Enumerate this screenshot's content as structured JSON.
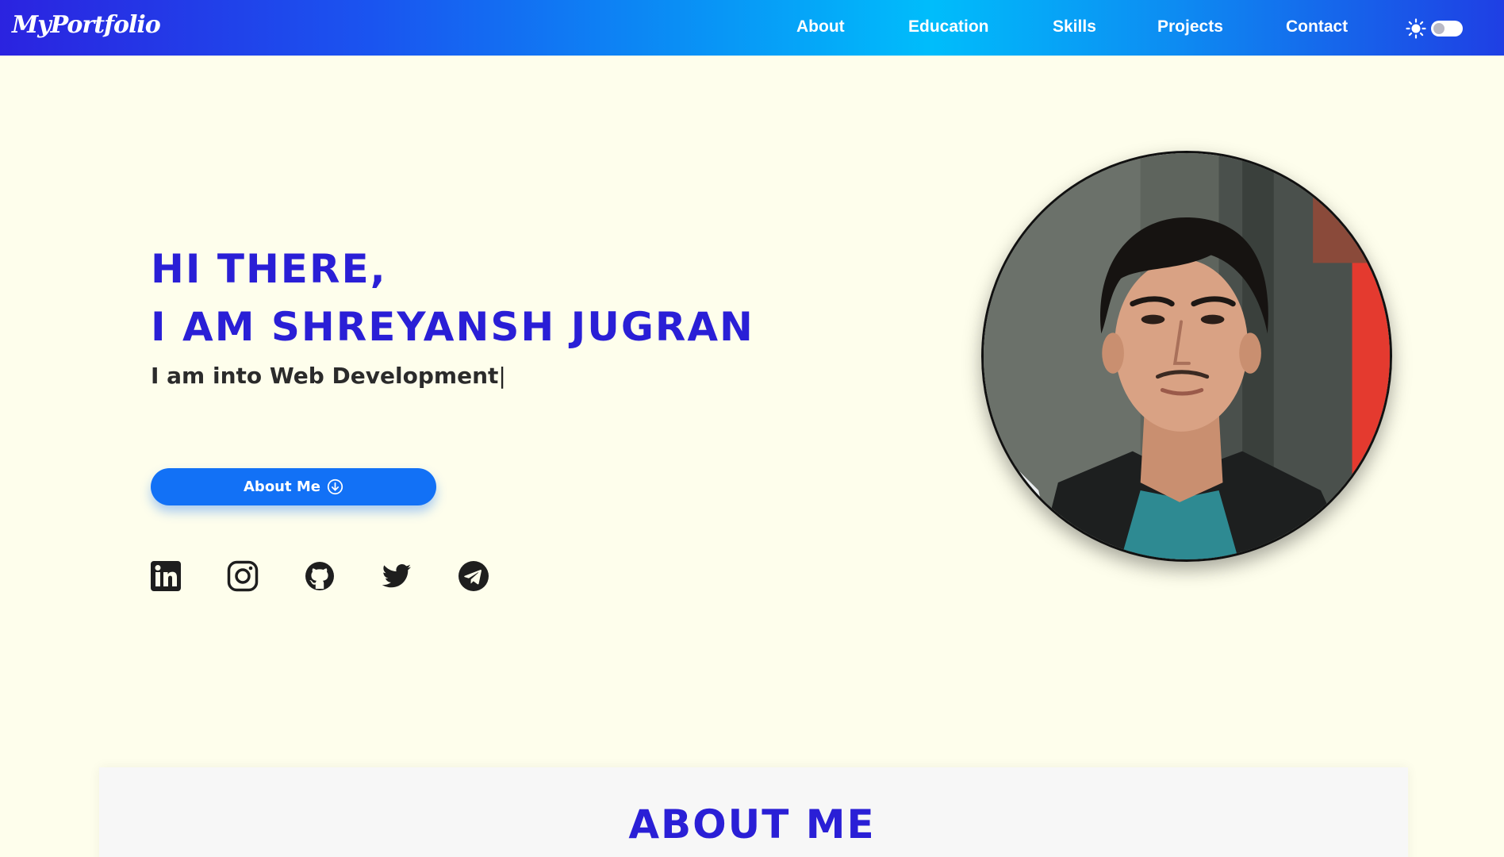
{
  "header": {
    "logo": "MyPortfolio",
    "nav": [
      "About",
      "Education",
      "Skills",
      "Projects",
      "Contact"
    ],
    "theme_toggle": {
      "icon": "sun-icon",
      "state": "light"
    },
    "gradient": [
      "#2b23e0",
      "#00bdfb",
      "#1f3fe4"
    ]
  },
  "hero": {
    "greeting": "HI THERE,",
    "name_line": "I AM SHREYANSH JUGRAN",
    "typed_text": "I am into Web Development",
    "cursor": "|",
    "button": {
      "label": "About Me",
      "icon": "arrow-down-circle-icon"
    },
    "socials": [
      {
        "name": "linkedin-icon"
      },
      {
        "name": "instagram-icon"
      },
      {
        "name": "github-icon"
      },
      {
        "name": "twitter-icon"
      },
      {
        "name": "telegram-icon"
      }
    ]
  },
  "about": {
    "title": "ABOUT ME"
  },
  "colors": {
    "background": "#fefeec",
    "heading": "#2a1fd6",
    "button": "#1271f6",
    "text": "#2b2b2b"
  }
}
